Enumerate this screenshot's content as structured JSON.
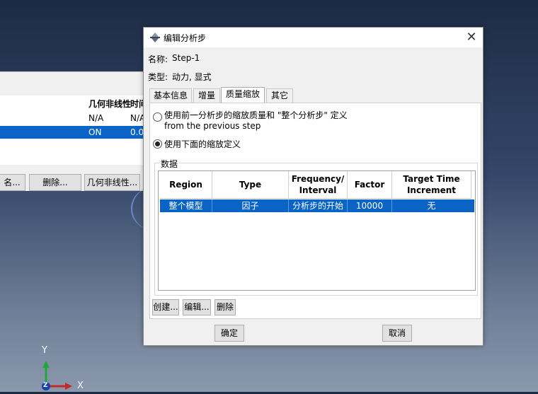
{
  "background": {
    "step_manager": {
      "col_headers": [
        "几何非线性",
        "时间"
      ],
      "rows": [
        [
          "N/A",
          "N/A"
        ],
        [
          "ON",
          "0.0"
        ]
      ],
      "buttons": [
        "名...",
        "删除...",
        "几何非线性..."
      ]
    },
    "triad": {
      "y": "Y",
      "x": "X",
      "z": "Z"
    }
  },
  "dialog": {
    "title": "编辑分析步",
    "close_glyph": "✕",
    "name_label": "名称:",
    "name_value": "Step-1",
    "type_label": "类型:",
    "type_value": "动力, 显式",
    "tabs": [
      "基本信息",
      "增量",
      "质量缩放",
      "其它"
    ],
    "active_tab": "质量缩放",
    "option1_line1": "使用前一分析步的缩放质量和 \"整个分析步\" 定义",
    "option1_line2": "from the previous step",
    "option2": "使用下面的缩放定义",
    "group_title": "数据",
    "table": {
      "headers": [
        {
          "line1": "Region",
          "line2": ""
        },
        {
          "line1": "Type",
          "line2": ""
        },
        {
          "line1": "Frequency/",
          "line2": "Interval"
        },
        {
          "line1": "Factor",
          "line2": ""
        },
        {
          "line1": "Target Time",
          "line2": "Increment"
        }
      ],
      "rows": [
        [
          "整个模型",
          "因子",
          "分析步的开始",
          "10000",
          "无"
        ]
      ]
    },
    "table_buttons": [
      "创建...",
      "编辑...",
      "删除"
    ],
    "ok": "确定",
    "cancel": "取消"
  },
  "colors": {
    "selection": "#0a64c6",
    "axis_y": "#1fa83a",
    "axis_x": "#c62828",
    "axis_z": "#1a3fb0"
  }
}
